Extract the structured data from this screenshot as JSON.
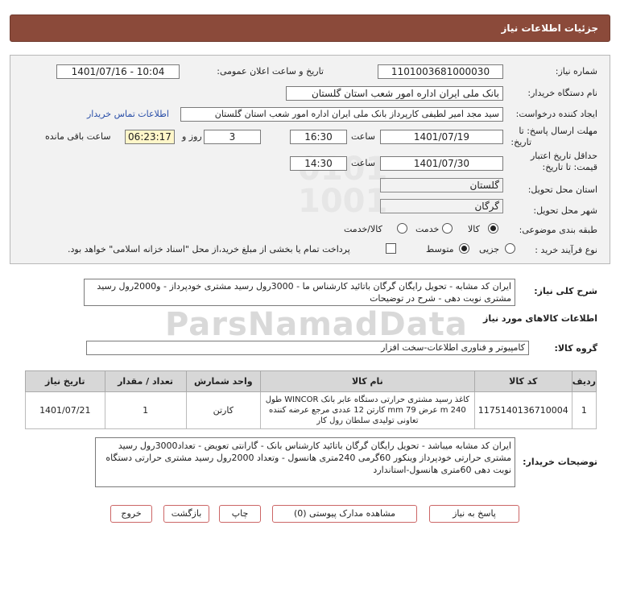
{
  "header": {
    "title": "جزئیات اطلاعات نیاز"
  },
  "fields": {
    "need_number_label": "شماره نیاز:",
    "need_number": "1101003681000030",
    "announce_label": "تاریخ و ساعت اعلان عمومی:",
    "announce_value": "1401/07/16 - 10:04",
    "buyer_org_label": "نام دستگاه خریدار:",
    "buyer_org": "بانک ملی ایران اداره امور شعب استان گلستان",
    "creator_label": "ایجاد کننده درخواست:",
    "creator": "سید مجد امیر لطیفی کارپرداز بانک ملی ایران اداره امور شعب استان گلستان",
    "contact_link": "اطلاعات تماس خریدار",
    "reply_deadline_label_1": "مهلت ارسال پاسخ: تا",
    "reply_deadline_label_2": "تاریخ:",
    "reply_date": "1401/07/19",
    "time_label": "ساعت",
    "reply_time": "16:30",
    "days_value": "3",
    "days_label": "روز و",
    "remaining_time": "06:23:17",
    "remaining_label": "ساعت باقی مانده",
    "validity_label_1": "حداقل تاریخ اعتبار",
    "validity_label_2": "قیمت: تا تاریخ:",
    "validity_date": "1401/07/30",
    "validity_time": "14:30",
    "province_label": "استان محل تحویل:",
    "province": "گلستان",
    "city_label": "شهر محل تحویل:",
    "city": "گرگان",
    "category_label": "طبقه بندی موضوعی:",
    "category_options": [
      "کالا",
      "خدمت",
      "کالا/خدمت"
    ],
    "process_label": "نوع فرآیند خرید :",
    "process_options": [
      "جزیی",
      "متوسط"
    ],
    "payment_note": "پرداخت تمام یا بخشی از مبلغ خرید،از محل \"اسناد خزانه اسلامی\" خواهد بود."
  },
  "summary": {
    "label": "شرح کلی نیاز:",
    "text": "ایران کد مشابه  - تحویل رایگان گرگان  باتائید کارشناس ما - 3000رول رسید مشتری خودپرداز  - و2000رول رسید مشتری  نوبت دهی - شرح در توضیحات"
  },
  "goods_section": {
    "title": "اطلاعات کالاهای مورد نیاز",
    "group_label": "گروه کالا:",
    "group_value": "کامپیوتر و فناوری اطلاعات-سخت افزار"
  },
  "table": {
    "headers": [
      "ردیف",
      "کد کالا",
      "نام کالا",
      "واحد شمارش",
      "تعداد / مقدار",
      "تاریخ نیاز"
    ],
    "rows": [
      {
        "row": "1",
        "code": "1175140136710004",
        "name": "کاغذ رسید مشتری حرارتی دستگاه عابر بانک WINCOR طول 240 m عرض 79 mm کارتن 12 عددی مرجع عرضه کننده تعاونی تولیدی سلطان رول کار",
        "unit": "کارتن",
        "qty": "1",
        "date": "1401/07/21"
      }
    ]
  },
  "buyer_notes": {
    "label": "توضیحات خریدار:",
    "text": "ایران کد مشابه میباشد - تحویل رایگان گرگان  باتائید کارشناس بانک - گارانتی تعویض - تعداد3000رول رسید مشتری حرارتی خودپرداز وینکور 60گرمی 240متری هانسول - وتعداد 2000رول رسید مشتری حرارتی دستگاه نوبت دهی 60متری هانسول-استاندارد"
  },
  "buttons": {
    "reply": "پاسخ به نیاز",
    "attachments": "مشاهده مدارک پیوستی (0)",
    "print": "چاپ",
    "back": "بازگشت",
    "exit": "خروج"
  },
  "watermark": {
    "brand": "ParsNamadData"
  }
}
